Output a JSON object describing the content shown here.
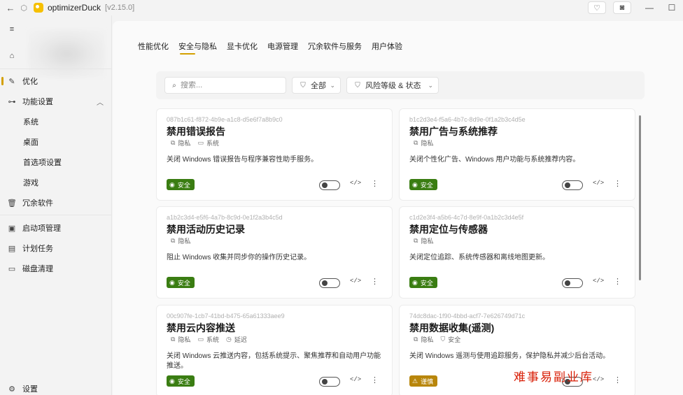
{
  "titlebar": {
    "app_name": "optimizerDuck",
    "version": "[v2.15.0]"
  },
  "sidebar": {
    "items": [
      {
        "label": "优化",
        "icon": "optimize-icon"
      },
      {
        "label": "功能设置",
        "icon": "toggle-icon"
      },
      {
        "label": "系统"
      },
      {
        "label": "桌面"
      },
      {
        "label": "首选项设置"
      },
      {
        "label": "游戏"
      },
      {
        "label": "冗余软件",
        "icon": "trash-icon"
      },
      {
        "label": "启动项管理",
        "icon": "startup-icon"
      },
      {
        "label": "计划任务",
        "icon": "calendar-icon"
      },
      {
        "label": "磁盘清理",
        "icon": "disk-icon"
      }
    ],
    "settings": "设置"
  },
  "tabs": [
    "性能优化",
    "安全与隐私",
    "显卡优化",
    "电源管理",
    "冗余软件与服务",
    "用户体验"
  ],
  "active_tab": "安全与隐私",
  "filters": {
    "search_placeholder": "搜索...",
    "category": "全部",
    "risk": "风险等级 & 状态"
  },
  "cards": [
    {
      "guid": "087b1c61-f872-4b9e-a1c8-d5e6f7a8b9c0",
      "title": "禁用错误报告",
      "tags": [
        "隐私",
        "系统"
      ],
      "desc": "关闭 Windows 错误报告与程序兼容性助手服务。",
      "risk": "安全"
    },
    {
      "guid": "b1c2d3e4-f5a6-4b7c-8d9e-0f1a2b3c4d5e",
      "title": "禁用广告与系统推荐",
      "tags": [
        "隐私"
      ],
      "desc": "关闭个性化广告、Windows 用户功能与系统推荐内容。",
      "risk": "安全"
    },
    {
      "guid": "a1b2c3d4-e5f6-4a7b-8c9d-0e1f2a3b4c5d",
      "title": "禁用活动历史记录",
      "tags": [
        "隐私"
      ],
      "desc": "阻止 Windows 收集并同步你的操作历史记录。",
      "risk": "安全"
    },
    {
      "guid": "c1d2e3f4-a5b6-4c7d-8e9f-0a1b2c3d4e5f",
      "title": "禁用定位与传感器",
      "tags": [
        "隐私"
      ],
      "desc": "关闭定位追踪、系统传感器和离线地图更新。",
      "risk": "安全"
    },
    {
      "guid": "00c907fe-1cb7-41bd-b475-65a61333aee9",
      "title": "禁用云内容推送",
      "tags": [
        "隐私",
        "系统",
        "延迟"
      ],
      "desc": "关闭 Windows 云推送内容，包括系统提示、聚焦推荐和自动用户功能推送。",
      "risk": "安全"
    },
    {
      "guid": "74dc8dac-1f90-4bbd-acf7-7e626749d71c",
      "title": "禁用数据收集(遥测)",
      "tags": [
        "隐私",
        "安全"
      ],
      "desc": "关闭 Windows 遥测与使用追踪服务，保护隐私并减少后台活动。",
      "risk": "谨慎"
    }
  ],
  "colors": {
    "safe": "#3a7d12",
    "caution": "#b8860b",
    "accent": "#d4a000"
  },
  "watermark": "难事易副业库"
}
